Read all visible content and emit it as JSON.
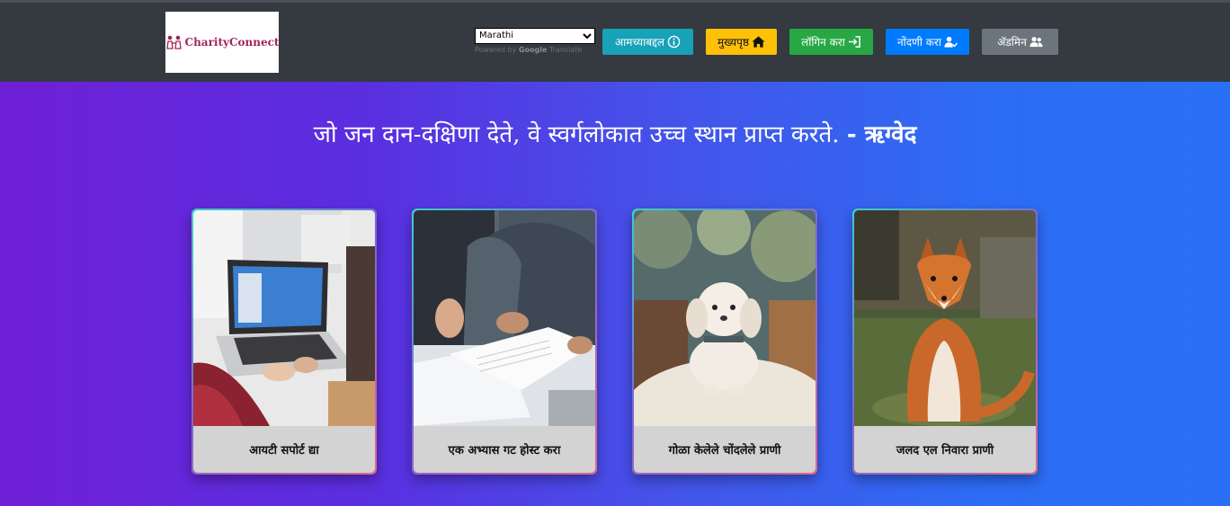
{
  "logo": {
    "text": "CharityConnect"
  },
  "translate": {
    "selected_language": "Marathi",
    "powered_prefix": "Powered by",
    "powered_brand": "Google",
    "powered_suffix": "Translate"
  },
  "nav": {
    "about_label": "आमच्याबद्दल",
    "home_label": "मुख्यपृष्ठ",
    "login_label": "लॉगिन करा",
    "register_label": "नोंदणी करा",
    "admin_label": "ॲडमिन"
  },
  "hero": {
    "quote": "जो जन दान-दक्षिणा देते, वे स्वर्गलोकात उच्च स्थान प्राप्त करते.",
    "author": "- ऋग्वेद"
  },
  "cards": [
    {
      "title": "आयटी सपोर्ट द्या",
      "image": "laptop-typing-photo"
    },
    {
      "title": "एक अभ्यास गट होस्ट करा",
      "image": "study-group-books-photo"
    },
    {
      "title": "गोळा केलेले चोंदलेले प्राणी",
      "image": "white-poodle-photo"
    },
    {
      "title": "जलद एल निवारा प्राणी",
      "image": "red-fox-photo"
    }
  ],
  "colors": {
    "navbar": "#343a40",
    "about": "#17a2b8",
    "home": "#ffc107",
    "login": "#28a745",
    "register": "#007bff",
    "admin": "#6c757d"
  }
}
